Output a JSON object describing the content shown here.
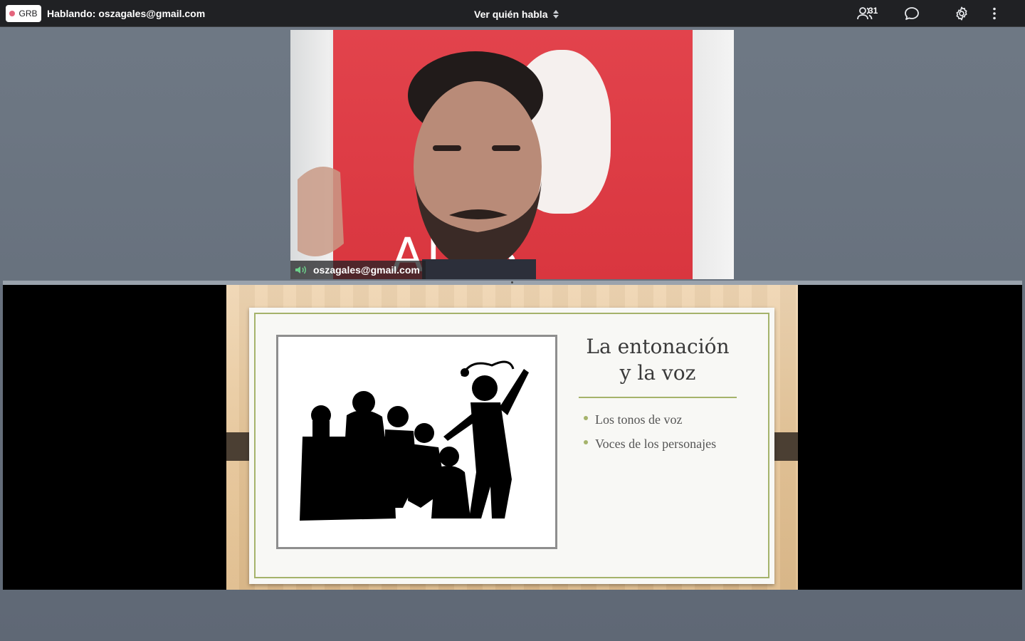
{
  "topbar": {
    "recording_label": "GRB",
    "speaking_label": "Hablando: oszagales@gmail.com",
    "view_selector": "Ver quién habla",
    "participants_count": "31",
    "icons": {
      "participants": "people-icon",
      "chat": "chat-icon",
      "settings": "gear-icon",
      "more": "more-vert-icon"
    },
    "colors": {
      "bar": "#202124",
      "record_dot": "#e4657d"
    }
  },
  "video": {
    "participant_name": "oszagales@gmail.com",
    "banner_text": "ALES",
    "audio_icon": "speaker-icon",
    "colors": {
      "banner": "#e2434c",
      "audio": "#6ccf8a"
    }
  },
  "slide": {
    "title": "La entonación\ny la voz",
    "bullets": [
      "Los tonos de voz",
      "Voces de los personajes"
    ],
    "illustration": "puppet-show-silhouette",
    "colors": {
      "accent": "#a5b36b",
      "tabs": "#4b3f33"
    }
  }
}
